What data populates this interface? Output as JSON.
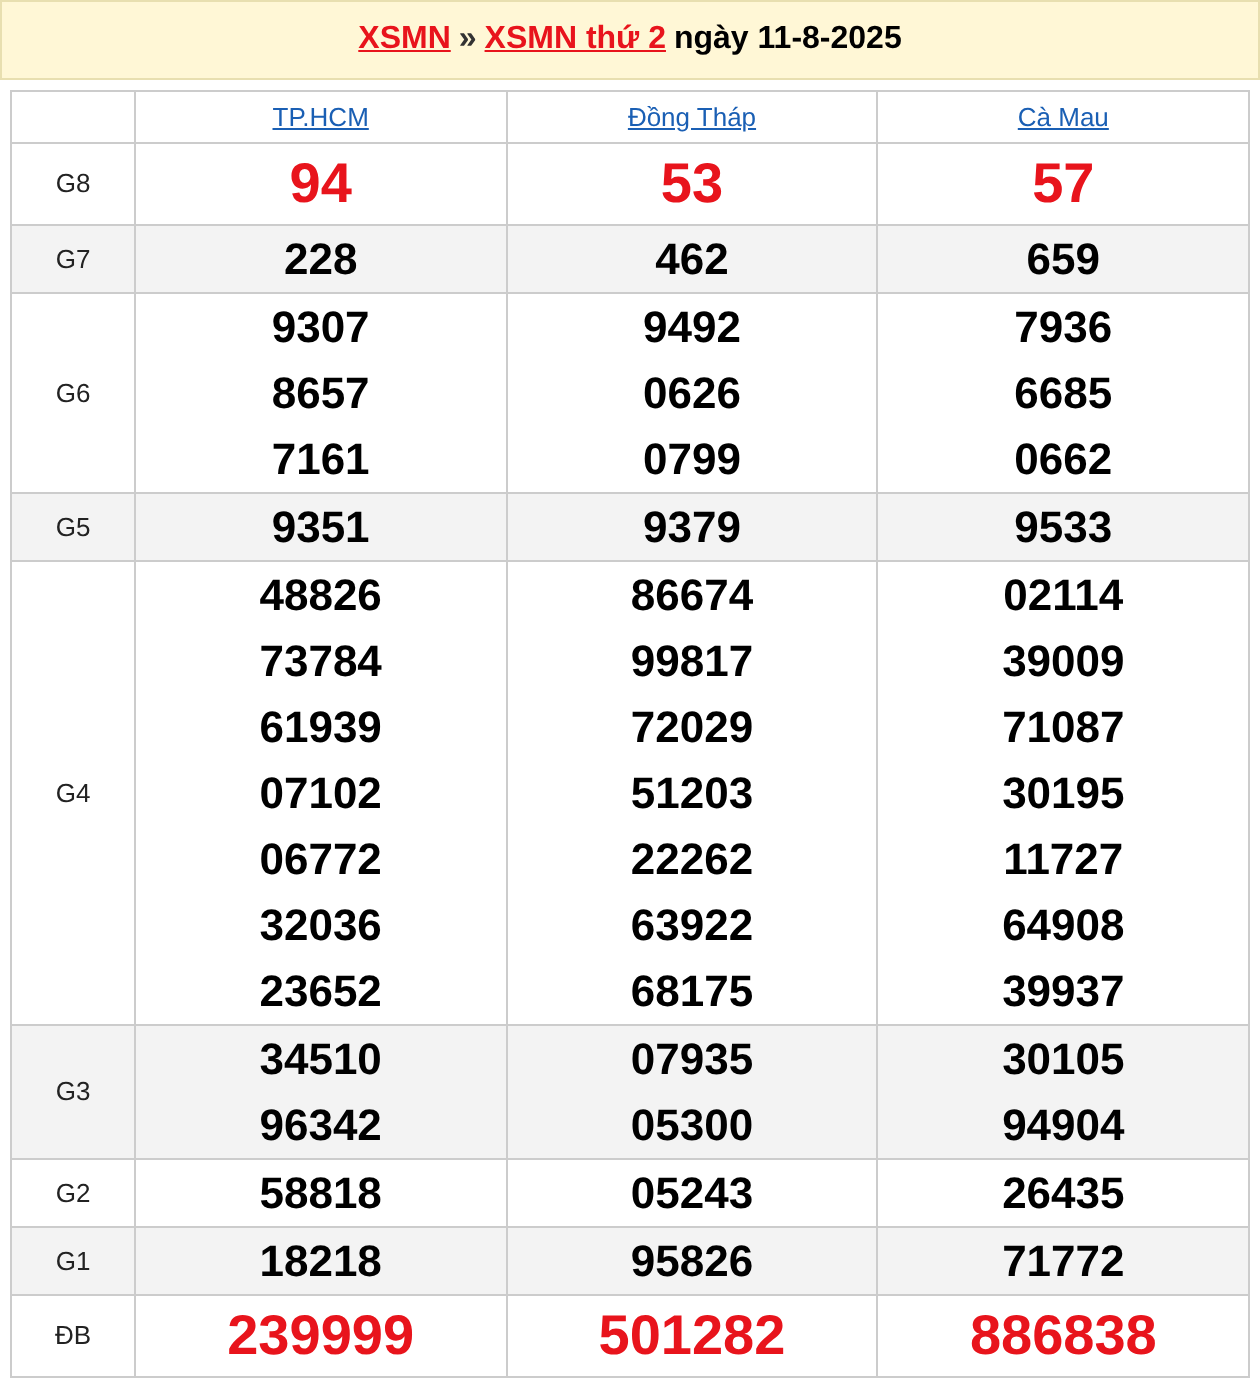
{
  "breadcrumb": [
    {
      "kind": "link",
      "text": "XSMN"
    },
    {
      "kind": "separator",
      "text": "»"
    },
    {
      "kind": "link",
      "text": "XSMN thứ 2"
    },
    {
      "kind": "text",
      "text": "ngày 11-8-2025"
    }
  ],
  "table": {
    "columns": [
      "TP.HCM",
      "Đồng Tháp",
      "Cà Mau"
    ],
    "rows": [
      {
        "prize": "G8",
        "highlight": true,
        "cells": [
          [
            "94"
          ],
          [
            "53"
          ],
          [
            "57"
          ]
        ]
      },
      {
        "prize": "G7",
        "highlight": false,
        "cells": [
          [
            "228"
          ],
          [
            "462"
          ],
          [
            "659"
          ]
        ]
      },
      {
        "prize": "G6",
        "highlight": false,
        "cells": [
          [
            "9307",
            "8657",
            "7161"
          ],
          [
            "9492",
            "0626",
            "0799"
          ],
          [
            "7936",
            "6685",
            "0662"
          ]
        ]
      },
      {
        "prize": "G5",
        "highlight": false,
        "cells": [
          [
            "9351"
          ],
          [
            "9379"
          ],
          [
            "9533"
          ]
        ]
      },
      {
        "prize": "G4",
        "highlight": false,
        "cells": [
          [
            "48826",
            "73784",
            "61939",
            "07102",
            "06772",
            "32036",
            "23652"
          ],
          [
            "86674",
            "99817",
            "72029",
            "51203",
            "22262",
            "63922",
            "68175"
          ],
          [
            "02114",
            "39009",
            "71087",
            "30195",
            "11727",
            "64908",
            "39937"
          ]
        ]
      },
      {
        "prize": "G3",
        "highlight": false,
        "cells": [
          [
            "34510",
            "96342"
          ],
          [
            "07935",
            "05300"
          ],
          [
            "30105",
            "94904"
          ]
        ]
      },
      {
        "prize": "G2",
        "highlight": false,
        "cells": [
          [
            "58818"
          ],
          [
            "05243"
          ],
          [
            "26435"
          ]
        ]
      },
      {
        "prize": "G1",
        "highlight": false,
        "cells": [
          [
            "18218"
          ],
          [
            "95826"
          ],
          [
            "71772"
          ]
        ]
      },
      {
        "prize": "ĐB",
        "highlight": true,
        "cells": [
          [
            "239999"
          ],
          [
            "501282"
          ],
          [
            "886838"
          ]
        ]
      }
    ]
  }
}
